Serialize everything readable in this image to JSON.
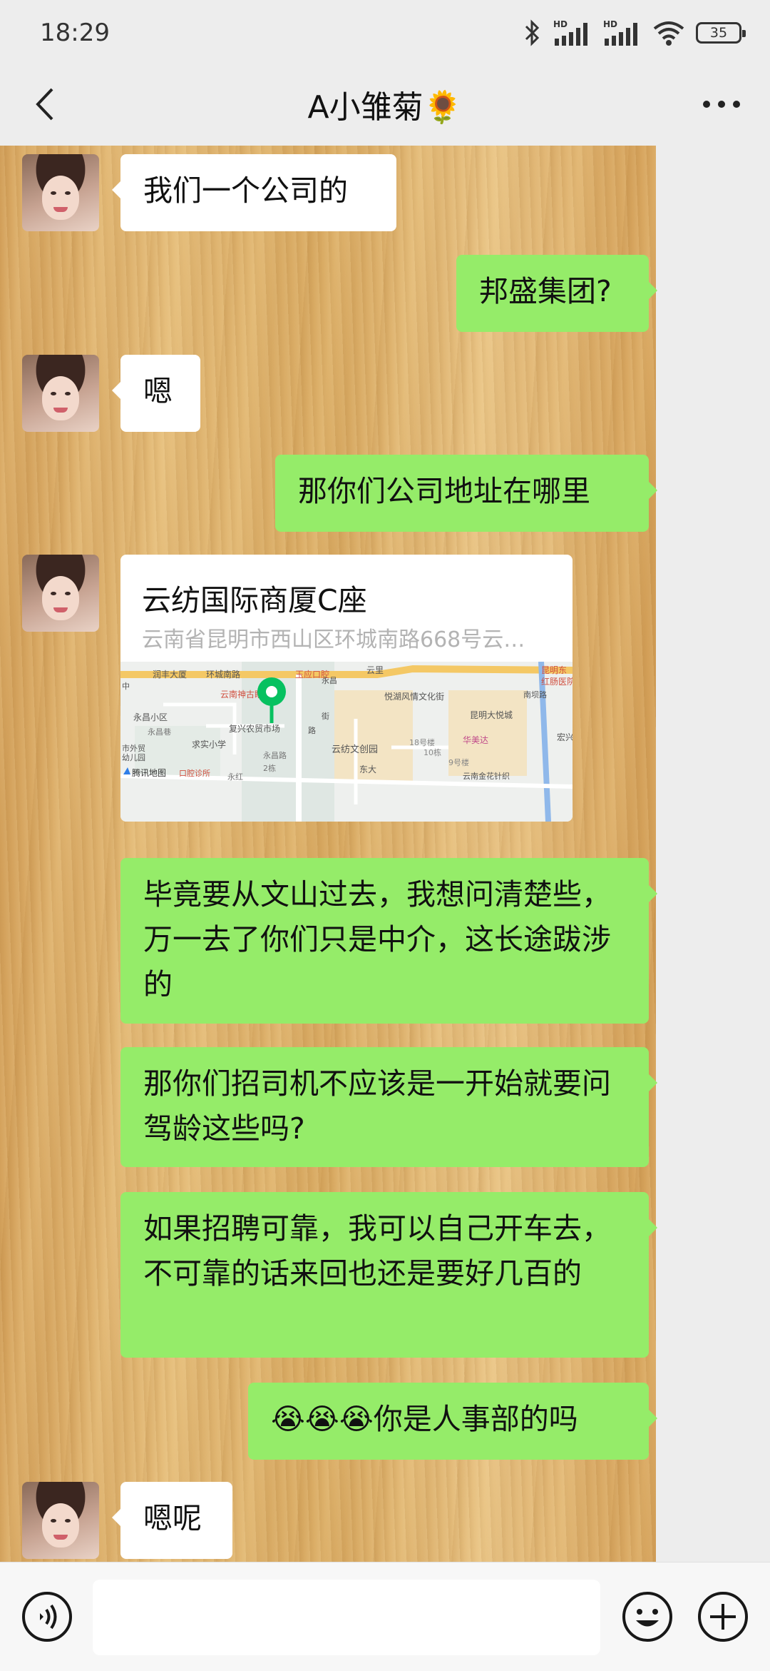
{
  "status_bar": {
    "time": "18:29",
    "battery": "35",
    "signal_1": "HD",
    "signal_2": "HD"
  },
  "header": {
    "title": "A小雏菊🌻"
  },
  "messages": [
    {
      "from": "contact",
      "text": "我们一个公司的"
    },
    {
      "from": "me",
      "text": "邦盛集团?"
    },
    {
      "from": "contact",
      "text": "嗯"
    },
    {
      "from": "me",
      "text": "那你们公司地址在哪里"
    },
    {
      "from": "contact",
      "type": "location",
      "title": "云纺国际商厦C座",
      "address": "云南省昆明市西山区环城南路668号云…",
      "map_labels": [
        "润丰大厦",
        "环城南路",
        "玉应口腔",
        "云里",
        "昆明东",
        "红肠医院",
        "云南神古眼科",
        "悦湖风情文化街",
        "永昌小区",
        "永昌巷",
        "复兴农贸市场",
        "求实小学",
        "东大",
        "昆明大悦城",
        "南坝路",
        "宏兴",
        "云纺文创园",
        "18号楼",
        "10栋",
        "华美达",
        "9号楼",
        "永昌路",
        "2栋",
        "云南金花针织",
        "腾讯地图",
        "口腔诊所",
        "永红",
        "市外贸",
        "幼儿园",
        "中",
        "路",
        "永昌",
        "街"
      ]
    },
    {
      "from": "me",
      "text": "毕竟要从文山过去，我想问清楚些，万一去了你们只是中介，这长途跋涉的"
    },
    {
      "from": "me",
      "text": "那你们招司机不应该是一开始就要问驾龄这些吗?"
    },
    {
      "from": "me",
      "text": "如果招聘可靠，我可以自己开车去，不可靠的话来回也还是要好几百的"
    },
    {
      "from": "me",
      "text": "😭😭😭你是人事部的吗"
    },
    {
      "from": "contact",
      "text": "嗯呢"
    }
  ]
}
